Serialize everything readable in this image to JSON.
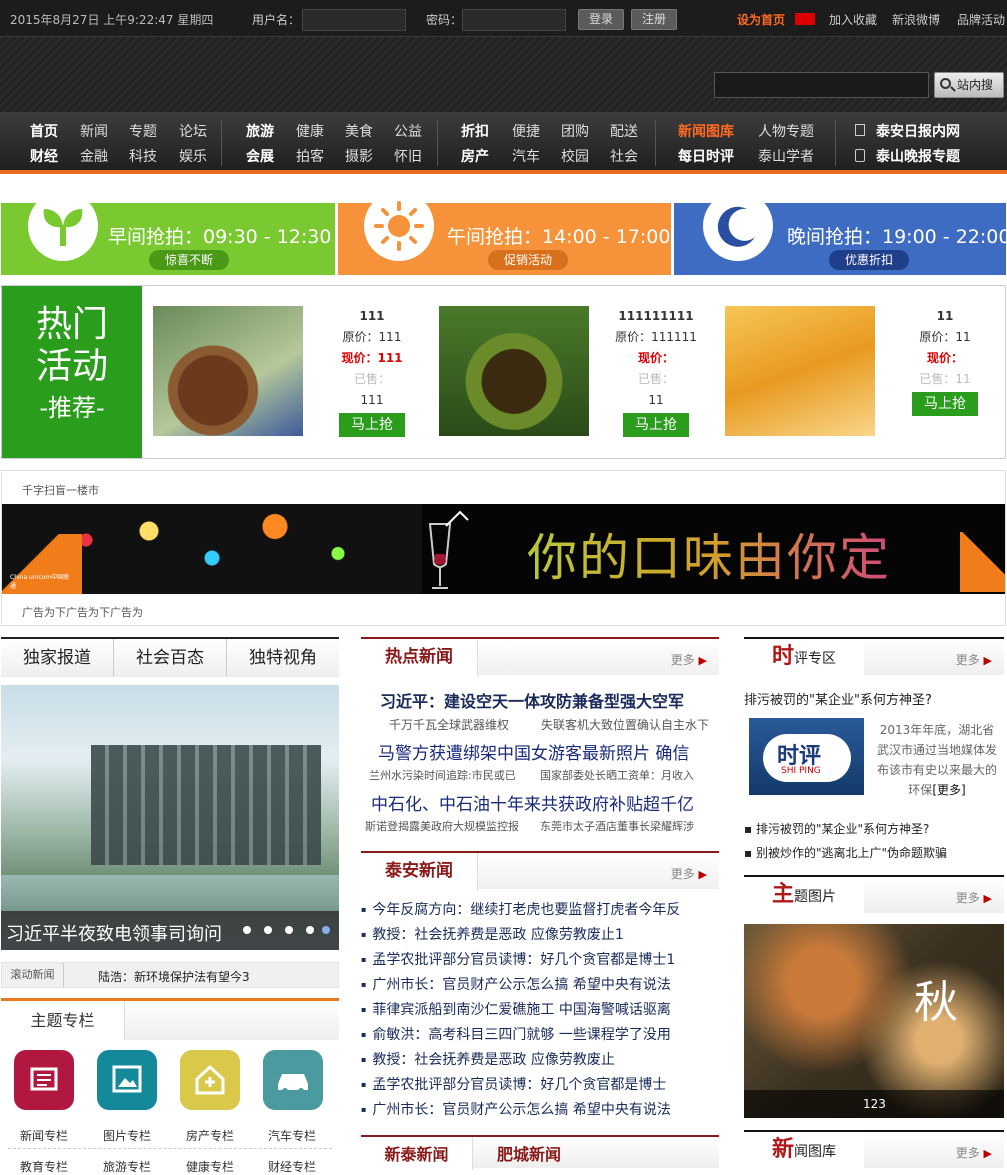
{
  "topbar": {
    "datetime": "2015年8月27日 上午9:22:47 星期四",
    "username_label": "用户名：",
    "password_label": "密码：",
    "login": "登录",
    "register": "注册",
    "set_home": "设为首页",
    "add_fav": "加入收藏",
    "weibo": "新浪微博",
    "brand": "品牌活动"
  },
  "search": {
    "placeholder": "",
    "button": "站内搜索"
  },
  "nav": {
    "g1": [
      "首页",
      "新闻",
      "专题",
      "论坛",
      "财经",
      "金融",
      "科技",
      "娱乐"
    ],
    "g2": [
      "旅游",
      "健康",
      "美食",
      "公益",
      "会展",
      "拍客",
      "摄影",
      "怀旧"
    ],
    "g3": [
      "折扣",
      "便捷",
      "团购",
      "配送",
      "房产",
      "汽车",
      "校园",
      "社会"
    ],
    "g4": [
      "新闻图库",
      "人物专题",
      "每日时评",
      "泰山学者"
    ],
    "g5": [
      "泰安日报内网",
      "泰山晚报专题"
    ]
  },
  "times": [
    {
      "label": "早间抢拍：09:30 - 12:30",
      "pill": "惊喜不断",
      "color": "#7ac930"
    },
    {
      "label": "午间抢拍：14:00 - 17:00",
      "pill": "促销活动",
      "color": "#f5923a"
    },
    {
      "label": "晚间抢拍：19:00 - 22:00",
      "pill": "优惠折扣",
      "color": "#3d6cc2"
    }
  ],
  "hot": {
    "title1": "热门",
    "title2": "活动",
    "sub": "-推荐-",
    "products": [
      {
        "name": "111",
        "orig": "原价：111",
        "now": "现价：111",
        "sold": "已售：",
        "count": "111",
        "buy": "马上抢"
      },
      {
        "name": "111111111",
        "orig": "原价：111111",
        "now": "现价：",
        "sold": "已售：",
        "count": "11",
        "buy": "马上抢"
      },
      {
        "name": "11",
        "orig": "原价：11",
        "now": "现价：",
        "sold": "已售：11",
        "count": "",
        "buy": "马上抢"
      }
    ]
  },
  "ad": {
    "top": "千字扫盲一楼市",
    "slogan": "你的口味由你定",
    "bottom": "广告为下广告为下广告为",
    "brand": "China unicom中国联通"
  },
  "left": {
    "tabs": [
      "独家报道",
      "社会百态",
      "独特视角"
    ],
    "slide_caption": "习近平半夜致电领事司询问",
    "scroll_label": "滚动新闻",
    "scroll_text": "陆浩：新环境保护法有望今3",
    "column_title": "主题专栏",
    "cats": [
      "新闻专栏",
      "图片专栏",
      "房产专栏",
      "汽车专栏"
    ],
    "cats2": [
      "教育专栏",
      "旅游专栏",
      "健康专栏",
      "财经专栏"
    ]
  },
  "mid": {
    "hot_title": "热点新闻",
    "more": "更多",
    "head1": "习近平：建设空天一体攻防兼备型强大空军",
    "sub1a": "千万千瓦全球武器维权",
    "sub1b": "失联客机大致位置确认自主水下",
    "head2": "马警方获遭绑架中国女游客最新照片 确信",
    "sub2a": "兰州水污染时间追踪:市民或已",
    "sub2b": "国家部委处长晒工资单：月收入",
    "head3": "中石化、中石油十年来共获政府补贴超千亿",
    "sub3a": "斯诺登揭露美政府大规模监控报",
    "sub3b": "东莞市太子酒店董事长梁耀辉涉",
    "taian_title": "泰安新闻",
    "list": [
      "今年反腐方向：继续打老虎也要监督打虎者今年反",
      "教授：社会抚养费是恶政 应像劳教废止1",
      "孟学农批评部分官员读博：好几个贪官都是博士1",
      "广州市长：官员财产公示怎么搞 希望中央有说法",
      "菲律宾派船到南沙仁爱礁施工 中国海警喊话驱离",
      "俞敏洪：高考科目三四门就够 一些课程学了没用",
      "教授：社会抚养费是恶政 应像劳教废止",
      "孟学农批评部分官员读博：好几个贪官都是博士",
      "广州市长：官员财产公示怎么搞 希望中央有说法"
    ],
    "tab_a": "新泰新闻",
    "tab_b": "肥城新闻"
  },
  "right": {
    "review_big": "时",
    "review_rest": "评专区",
    "more": "更多",
    "q": "排污被罚的\"某企业\"系何方神圣?",
    "logo_text": "时评",
    "logo_sub": "SHI PING",
    "desc": "2013年年底，湖北省武汉市通过当地媒体发布该市有史以来最大的环保",
    "desc_more": "[更多]",
    "items": [
      "排污被罚的\"某企业\"系何方神圣?",
      "别被炒作的\"逃离北上广\"伪命题欺骗"
    ],
    "pic_big": "主",
    "pic_rest": "题图片",
    "pic_word": "秋",
    "pic_caption": "123",
    "lib_big": "新",
    "lib_rest": "闻图库"
  }
}
